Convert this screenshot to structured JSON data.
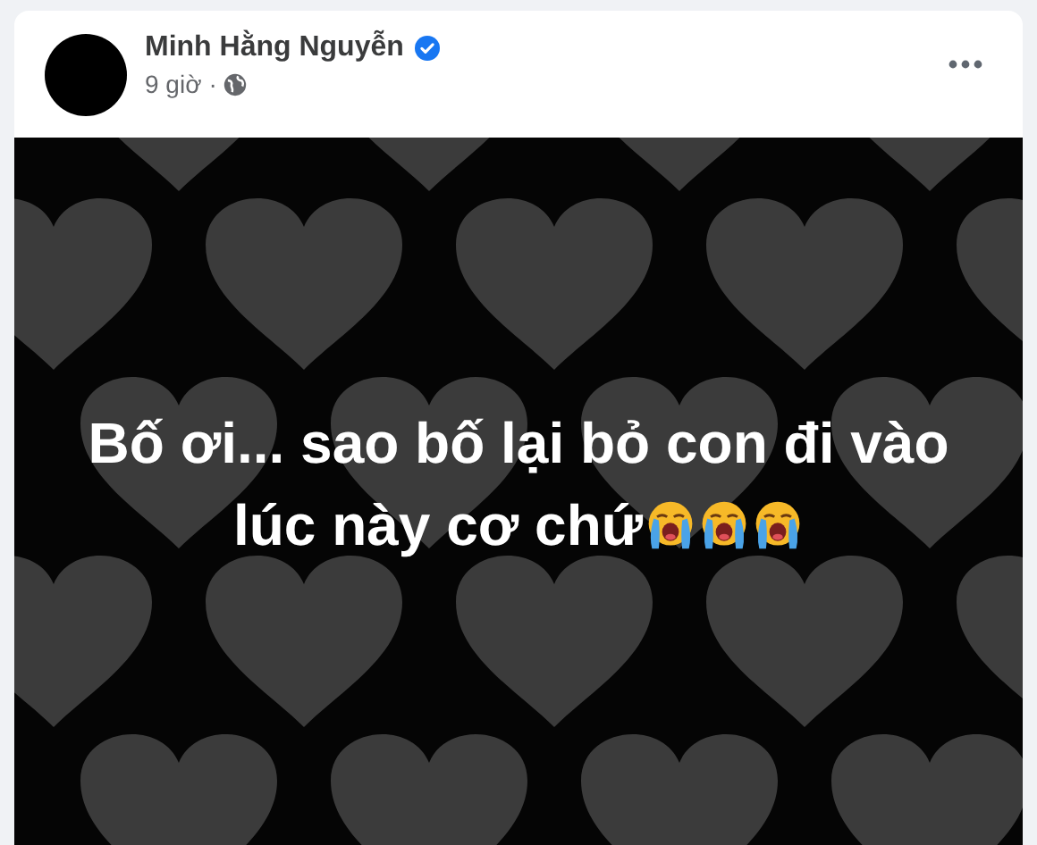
{
  "post": {
    "author": "Minh Hằng Nguyễn",
    "verified": true,
    "time": "9 giờ",
    "separator": "·"
  },
  "status": {
    "lines": [
      "Bố ơi... sao bố lại bỏ con đi vào",
      "lúc này cơ chứ"
    ],
    "emoji": [
      {
        "kind": "crying"
      },
      {
        "kind": "crying"
      },
      {
        "kind": "crying"
      }
    ]
  }
}
